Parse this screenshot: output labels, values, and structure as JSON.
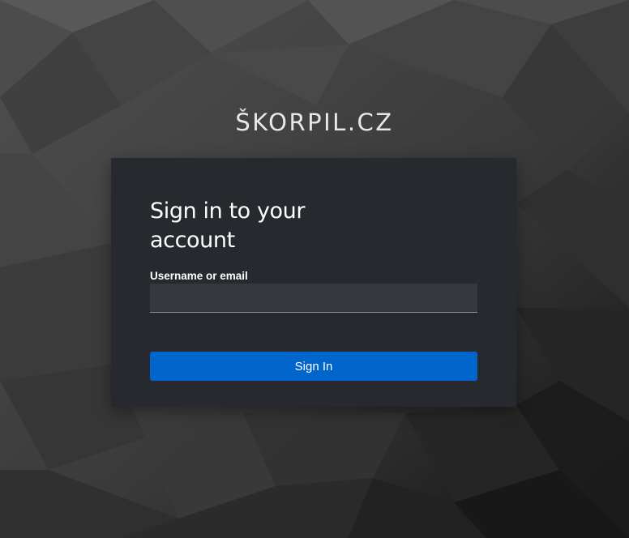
{
  "brand": {
    "name": "ŠKORPIL.CZ"
  },
  "login": {
    "title": "Sign in to your account",
    "username_label": "Username or email",
    "username_value": "",
    "submit_label": "Sign In"
  },
  "colors": {
    "card_background": "#26292d",
    "input_background": "#35383d",
    "button_primary": "#0066cc",
    "text": "#ffffff"
  }
}
